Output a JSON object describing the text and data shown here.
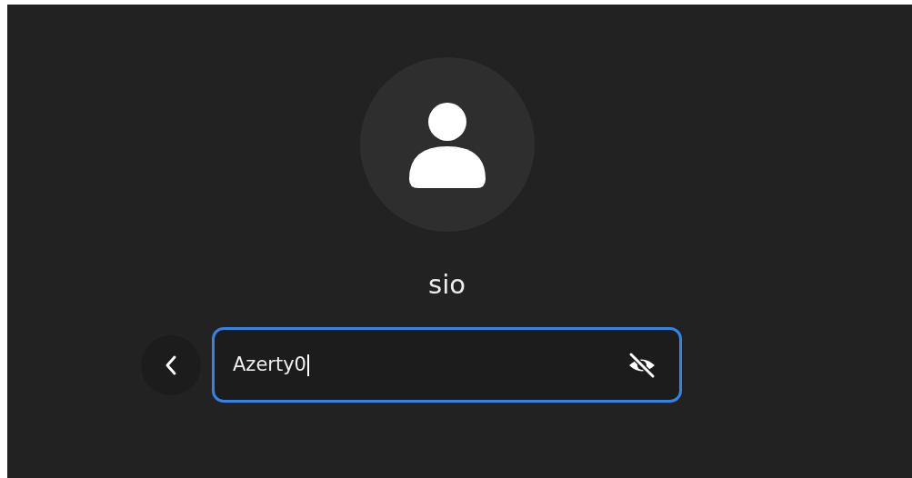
{
  "user": {
    "name": "sio"
  },
  "password_field": {
    "value": "Azerty0",
    "focused": true,
    "revealed": true
  }
}
